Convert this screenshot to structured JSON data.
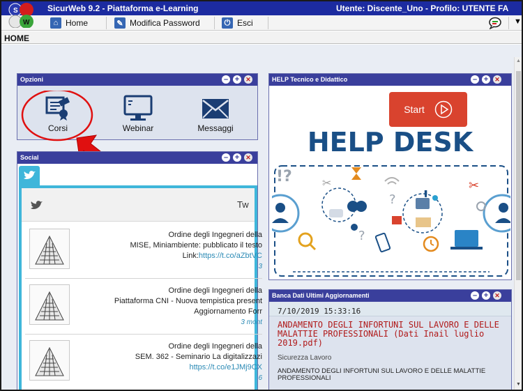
{
  "window": {
    "title": "SicurWeb 9.2 - Piattaforma e-Learning",
    "user_info": "Utente: Discente_Uno - Profilo: UTENTE FA",
    "logo_letters": [
      "S",
      "W"
    ]
  },
  "menu": {
    "items": [
      {
        "label": "Home",
        "icon": "home-icon"
      },
      {
        "label": "Modifica Password",
        "icon": "key-icon"
      },
      {
        "label": "Esci",
        "icon": "power-icon"
      }
    ]
  },
  "breadcrumb": "HOME",
  "options_panel": {
    "title": "Opzioni",
    "items": [
      {
        "label": "Corsi",
        "icon": "certificate-icon"
      },
      {
        "label": "Webinar",
        "icon": "monitor-icon"
      },
      {
        "label": "Messaggi",
        "icon": "envelope-icon"
      }
    ]
  },
  "social_panel": {
    "title": "Social",
    "feed_header": "Tw",
    "tweets": [
      {
        "line1": "Ordine degli Ingegneri della",
        "line2": "MISE, Miniambiente: pubblicato il testo",
        "line3_prefix": "Link:",
        "line3_link": "https://t.co/aZbtVC",
        "time": "3"
      },
      {
        "line1": "Ordine degli Ingegneri della",
        "line2": "Piattaforma CNI - Nuova tempistica present",
        "line3_prefix": "Aggiornamento Forr",
        "line3_link": "",
        "time": "3 mont"
      },
      {
        "line1": "Ordine degli Ingegneri della",
        "line2": "SEM. 362 - Seminario La digitalizzazi",
        "line3_prefix": "",
        "line3_link": "https://t.co/e1JMj9CX",
        "time": "6"
      }
    ]
  },
  "help_panel": {
    "title": "HELP Tecnico e Didattico",
    "start_label": "Start",
    "banner": "HELP DESK"
  },
  "news_panel": {
    "title": "Banca Dati Ultimi Aggiornamenti",
    "entries": [
      {
        "date": "7/10/2019 15:33:16",
        "title": "ANDAMENTO DEGLI INFORTUNI SUL LAVORO E DELLE MALATTIE PROFESSIONALI (Dati Inail luglio 2019.pdf)",
        "category": "Sicurezza Lavoro",
        "summary": "ANDAMENTO DEGLI INFORTUNI SUL LAVORO E DELLE MALATTIE PROFESSIONALI"
      }
    ]
  },
  "colors": {
    "titlebar": "#1c2ba0",
    "panel_header": "#3a3f9c",
    "annotation_red": "#e01010",
    "link": "#2b8ab5",
    "news_title": "#b01818",
    "helpdesk_blue": "#1a4f86"
  }
}
